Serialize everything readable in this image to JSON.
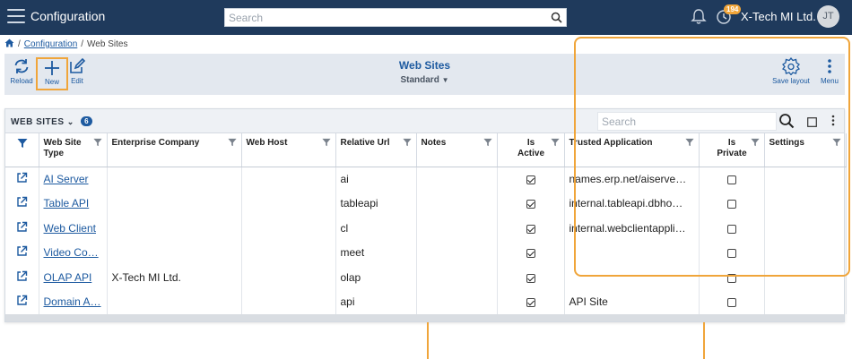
{
  "app": {
    "title": "Configuration",
    "company": "X-Tech MI Ltd.",
    "avatar_initials": "JT",
    "notification_count": "194"
  },
  "top_search": {
    "placeholder": "Search"
  },
  "breadcrumb": {
    "items": [
      "Configuration",
      "Web Sites"
    ]
  },
  "toolbar": {
    "reload_label": "Reload",
    "new_label": "New",
    "edit_label": "Edit",
    "view_title": "Web Sites",
    "view_variant": "Standard",
    "save_layout_label": "Save layout",
    "menu_label": "Menu"
  },
  "grid": {
    "title": "WEB SITES",
    "count": "6",
    "search_placeholder": "Search",
    "columns": [
      "Web Site Type",
      "Enterprise Company",
      "Web Host",
      "Relative Url",
      "Notes",
      "Is Active",
      "Trusted Application",
      "Is Private",
      "Settings"
    ],
    "rows": [
      {
        "type": "AI Server",
        "company": "",
        "host": "",
        "url": "ai",
        "notes": "",
        "active": true,
        "trusted": "names.erp.net/aiserve…",
        "private": false,
        "settings": ""
      },
      {
        "type": "Table API",
        "company": "",
        "host": "",
        "url": "tableapi",
        "notes": "",
        "active": true,
        "trusted": "internal.tableapi.dbho…",
        "private": false,
        "settings": ""
      },
      {
        "type": "Web Client",
        "company": "",
        "host": "",
        "url": "cl",
        "notes": "",
        "active": true,
        "trusted": "internal.webclientappli…",
        "private": false,
        "settings": ""
      },
      {
        "type": "Video Co…",
        "company": "",
        "host": "",
        "url": "meet",
        "notes": "",
        "active": true,
        "trusted": "",
        "private": false,
        "settings": ""
      },
      {
        "type": "OLAP API",
        "company": "X-Tech MI Ltd.",
        "host": "",
        "url": "olap",
        "notes": "",
        "active": true,
        "trusted": "",
        "private": false,
        "settings": ""
      },
      {
        "type": "Domain A…",
        "company": "",
        "host": "",
        "url": "api",
        "notes": "",
        "active": true,
        "trusted": "API Site",
        "private": false,
        "settings": ""
      }
    ]
  },
  "colors": {
    "header_bg": "#1f3a5c",
    "accent": "#1d5aa0",
    "highlight": "#f0a53a"
  }
}
